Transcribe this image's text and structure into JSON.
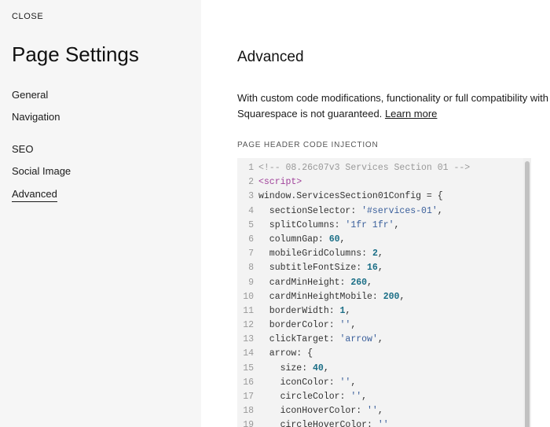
{
  "sidebar": {
    "close_label": "CLOSE",
    "title": "Page Settings",
    "items": [
      {
        "label": "General"
      },
      {
        "label": "Navigation"
      },
      {
        "label": "SEO"
      },
      {
        "label": "Social Image"
      },
      {
        "label": "Advanced",
        "active": true
      }
    ]
  },
  "main": {
    "section_title": "Advanced",
    "description": "With custom code modifications, functionality or full compatibility with Squarespace is not guaranteed.",
    "description_line1": "With custom code modifications, functionality or full compatibility with",
    "description_line2": "Squarespace is not guaranteed.",
    "learn_more": "Learn more",
    "field_label": "PAGE HEADER CODE INJECTION",
    "code_lines": [
      {
        "n": "1",
        "tokens": [
          [
            "c",
            "<!-- 08.26c07v3 Services Section 01 -->"
          ]
        ]
      },
      {
        "n": "2",
        "tokens": [
          [
            "t",
            "<script>"
          ]
        ]
      },
      {
        "n": "3",
        "tokens": [
          [
            "p",
            "window.ServicesSection01Config = {"
          ]
        ]
      },
      {
        "n": "4",
        "tokens": [
          [
            "p",
            "  sectionSelector: "
          ],
          [
            "s",
            "'#services-01'"
          ],
          [
            "p",
            ","
          ]
        ]
      },
      {
        "n": "5",
        "tokens": [
          [
            "p",
            "  splitColumns: "
          ],
          [
            "s",
            "'1fr 1fr'"
          ],
          [
            "p",
            ","
          ]
        ]
      },
      {
        "n": "6",
        "tokens": [
          [
            "p",
            "  columnGap: "
          ],
          [
            "n",
            "60"
          ],
          [
            "p",
            ","
          ]
        ]
      },
      {
        "n": "7",
        "tokens": [
          [
            "p",
            "  mobileGridColumns: "
          ],
          [
            "n",
            "2"
          ],
          [
            "p",
            ","
          ]
        ]
      },
      {
        "n": "8",
        "tokens": [
          [
            "p",
            "  subtitleFontSize: "
          ],
          [
            "n",
            "16"
          ],
          [
            "p",
            ","
          ]
        ]
      },
      {
        "n": "9",
        "tokens": [
          [
            "p",
            "  cardMinHeight: "
          ],
          [
            "n",
            "260"
          ],
          [
            "p",
            ","
          ]
        ]
      },
      {
        "n": "10",
        "tokens": [
          [
            "p",
            "  cardMinHeightMobile: "
          ],
          [
            "n",
            "200"
          ],
          [
            "p",
            ","
          ]
        ]
      },
      {
        "n": "11",
        "tokens": [
          [
            "p",
            "  borderWidth: "
          ],
          [
            "n",
            "1"
          ],
          [
            "p",
            ","
          ]
        ]
      },
      {
        "n": "12",
        "tokens": [
          [
            "p",
            "  borderColor: "
          ],
          [
            "s",
            "''"
          ],
          [
            "p",
            ","
          ]
        ]
      },
      {
        "n": "13",
        "tokens": [
          [
            "p",
            "  clickTarget: "
          ],
          [
            "s",
            "'arrow'"
          ],
          [
            "p",
            ","
          ]
        ]
      },
      {
        "n": "14",
        "tokens": [
          [
            "p",
            "  arrow: {"
          ]
        ]
      },
      {
        "n": "15",
        "tokens": [
          [
            "p",
            "    size: "
          ],
          [
            "n",
            "40"
          ],
          [
            "p",
            ","
          ]
        ]
      },
      {
        "n": "16",
        "tokens": [
          [
            "p",
            "    iconColor: "
          ],
          [
            "s",
            "''"
          ],
          [
            "p",
            ","
          ]
        ]
      },
      {
        "n": "17",
        "tokens": [
          [
            "p",
            "    circleColor: "
          ],
          [
            "s",
            "''"
          ],
          [
            "p",
            ","
          ]
        ]
      },
      {
        "n": "18",
        "tokens": [
          [
            "p",
            "    iconHoverColor: "
          ],
          [
            "s",
            "''"
          ],
          [
            "p",
            ","
          ]
        ]
      },
      {
        "n": "19",
        "tokens": [
          [
            "p",
            "    circleHoverColor: "
          ],
          [
            "s",
            "''"
          ]
        ]
      }
    ]
  },
  "colors": {
    "sidebar_bg": "#f6f6f6",
    "code_bg": "#f3f3f3",
    "comment": "#999999",
    "tag": "#a0429a",
    "string": "#3a5f9b",
    "number": "#1a6e86"
  }
}
